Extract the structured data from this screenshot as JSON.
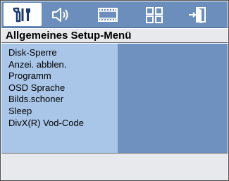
{
  "tabs": [
    {
      "icon": "setup-tools-icon",
      "active": true
    },
    {
      "icon": "speaker-audio-icon",
      "active": false
    },
    {
      "icon": "film-video-icon",
      "active": false
    },
    {
      "icon": "grid-preferences-icon",
      "active": false
    },
    {
      "icon": "exit-door-icon",
      "active": false
    }
  ],
  "header": {
    "title": "Allgemeines Setup-Menü"
  },
  "menu": {
    "items": [
      "Disk-Sperre",
      "Anzei. abblen.",
      "Programm",
      "OSD Sprache",
      "Bilds.schoner",
      "Sleep",
      "DivX(R) Vod-Code"
    ]
  },
  "colors": {
    "tab_bar": "#6b8ebd",
    "menu_left": "#a9c6e8",
    "menu_right": "#6f91c0",
    "header_bg": "#e7e9ec"
  }
}
